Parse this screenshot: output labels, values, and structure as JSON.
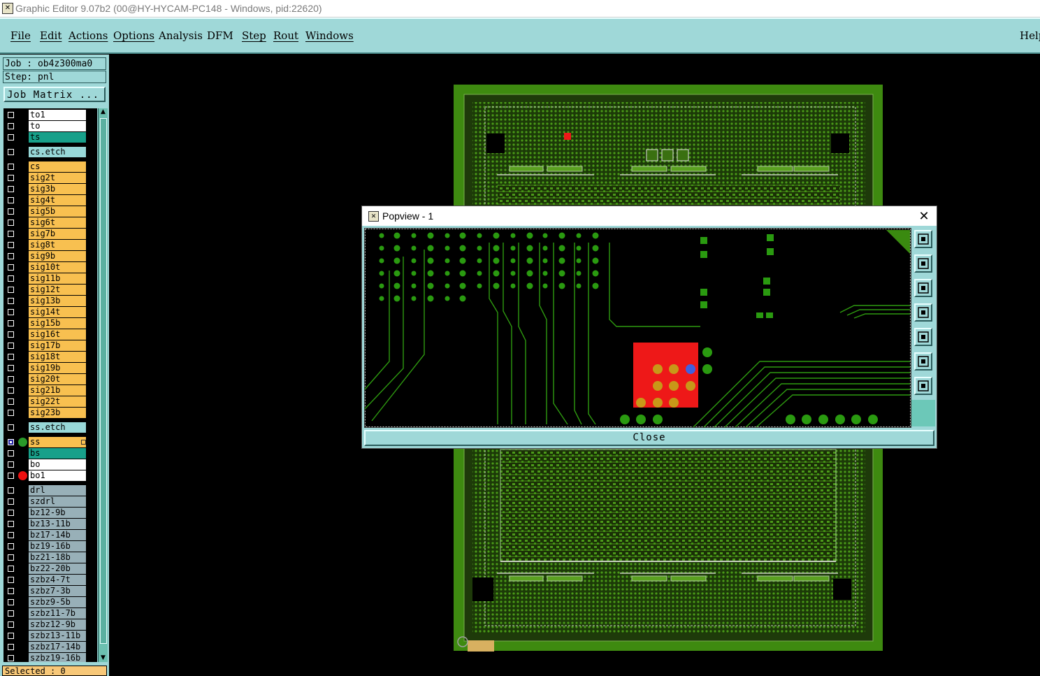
{
  "window": {
    "title": "Graphic Editor 9.07b2 (00@HY-HYCAM-PC148 - Windows, pid:22620)"
  },
  "menu": {
    "items": [
      "File",
      "Edit",
      "Actions",
      "Options",
      "Analysis",
      "DFM",
      "Step",
      "Rout",
      "Windows"
    ],
    "help": "Help"
  },
  "job": {
    "label": "Job : ob4z300ma0",
    "step": "Step: pnl",
    "matrix_button": "Job Matrix ..."
  },
  "layers": {
    "colors": {
      "white": "#ffffff",
      "teal": "#18a08a",
      "orange": "#f8c050",
      "gray": "#98b0b8",
      "cyan": "#98d8d8"
    },
    "rows": [
      {
        "name": "to1",
        "color": "white",
        "gap": 0
      },
      {
        "name": "to",
        "color": "white",
        "gap": 0
      },
      {
        "name": "ts",
        "color": "teal",
        "gap": 0
      },
      {
        "name": "cs.etch",
        "color": "cyan",
        "gap": 5
      },
      {
        "name": "cs",
        "color": "orange",
        "gap": 5
      },
      {
        "name": "sig2t",
        "color": "orange",
        "gap": 0
      },
      {
        "name": "sig3b",
        "color": "orange",
        "gap": 0
      },
      {
        "name": "sig4t",
        "color": "orange",
        "gap": 0
      },
      {
        "name": "sig5b",
        "color": "orange",
        "gap": 0
      },
      {
        "name": "sig6t",
        "color": "orange",
        "gap": 0
      },
      {
        "name": "sig7b",
        "color": "orange",
        "gap": 0
      },
      {
        "name": "sig8t",
        "color": "orange",
        "gap": 0
      },
      {
        "name": "sig9b",
        "color": "orange",
        "gap": 0
      },
      {
        "name": "sig10t",
        "color": "orange",
        "gap": 0
      },
      {
        "name": "sig11b",
        "color": "orange",
        "gap": 0
      },
      {
        "name": "sig12t",
        "color": "orange",
        "gap": 0
      },
      {
        "name": "sig13b",
        "color": "orange",
        "gap": 0
      },
      {
        "name": "sig14t",
        "color": "orange",
        "gap": 0
      },
      {
        "name": "sig15b",
        "color": "orange",
        "gap": 0
      },
      {
        "name": "sig16t",
        "color": "orange",
        "gap": 0
      },
      {
        "name": "sig17b",
        "color": "orange",
        "gap": 0
      },
      {
        "name": "sig18t",
        "color": "orange",
        "gap": 0
      },
      {
        "name": "sig19b",
        "color": "orange",
        "gap": 0
      },
      {
        "name": "sig20t",
        "color": "orange",
        "gap": 0
      },
      {
        "name": "sig21b",
        "color": "orange",
        "gap": 0
      },
      {
        "name": "sig22t",
        "color": "orange",
        "gap": 0
      },
      {
        "name": "sig23b",
        "color": "orange",
        "gap": 0
      },
      {
        "name": "ss.etch",
        "color": "cyan",
        "gap": 5
      },
      {
        "name": "ss",
        "color": "orange",
        "gap": 5,
        "checked": true,
        "dot": "#2a9a2a",
        "marker": true
      },
      {
        "name": "bs",
        "color": "teal",
        "gap": 0
      },
      {
        "name": "bo",
        "color": "white",
        "gap": 0
      },
      {
        "name": "bo1",
        "color": "white",
        "gap": 0,
        "dot": "#ee1010"
      },
      {
        "name": "drl",
        "color": "gray",
        "gap": 5
      },
      {
        "name": "szdrl",
        "color": "gray",
        "gap": 0
      },
      {
        "name": "bz12-9b",
        "color": "gray",
        "gap": 0
      },
      {
        "name": "bz13-11b",
        "color": "gray",
        "gap": 0
      },
      {
        "name": "bz17-14b",
        "color": "gray",
        "gap": 0
      },
      {
        "name": "bz19-16b",
        "color": "gray",
        "gap": 0
      },
      {
        "name": "bz21-18b",
        "color": "gray",
        "gap": 0
      },
      {
        "name": "bz22-20b",
        "color": "gray",
        "gap": 0
      },
      {
        "name": "szbz4-7t",
        "color": "gray",
        "gap": 0
      },
      {
        "name": "szbz7-3b",
        "color": "gray",
        "gap": 0
      },
      {
        "name": "szbz9-5b",
        "color": "gray",
        "gap": 0
      },
      {
        "name": "szbz11-7b",
        "color": "gray",
        "gap": 0
      },
      {
        "name": "szbz12-9b",
        "color": "gray",
        "gap": 0
      },
      {
        "name": "szbz13-11b",
        "color": "gray",
        "gap": 0
      },
      {
        "name": "szbz17-14b",
        "color": "gray",
        "gap": 0
      },
      {
        "name": "szbz19-16b",
        "color": "gray",
        "gap": 0
      }
    ]
  },
  "status": {
    "selected": "Selected : 0"
  },
  "popview": {
    "title": "Popview - 1",
    "close_label": "Close",
    "tools": [
      "zoom-home-icon",
      "pan-up-icon",
      "pan-down-icon",
      "pan-left-icon",
      "pan-right-icon",
      "zoom-in-icon",
      "zoom-out-icon"
    ]
  },
  "colors": {
    "board": "#3e8a10",
    "trace": "#2e9a10",
    "pad": "#2a9a10",
    "highlight": "#ee1818",
    "menu": "#9fd8d8"
  }
}
